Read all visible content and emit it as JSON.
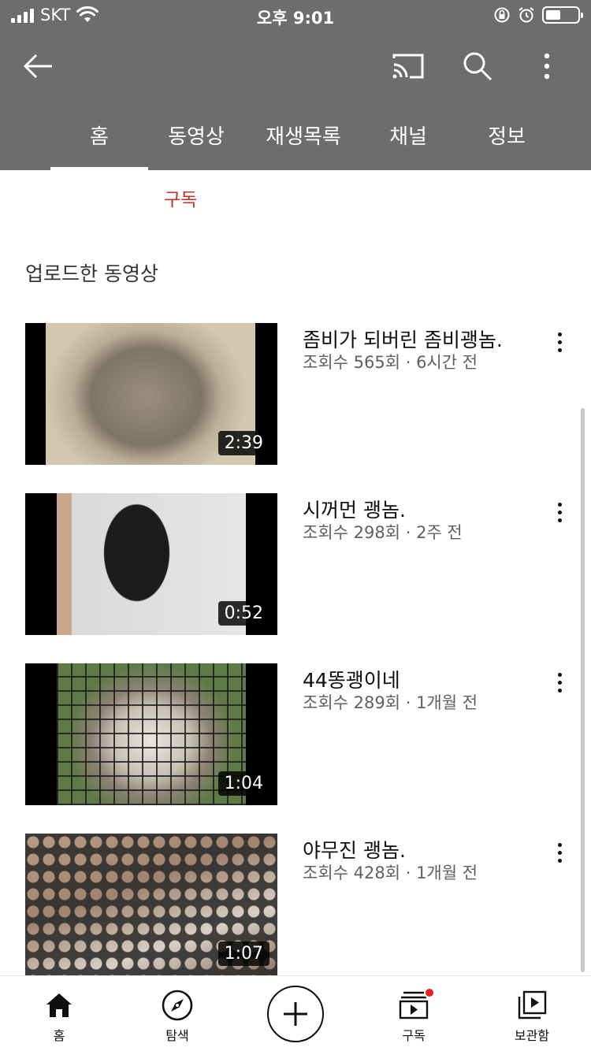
{
  "status_bar": {
    "carrier": "SKT",
    "time": "오후 9:01"
  },
  "tabs": [
    {
      "label": "홈",
      "active": true
    },
    {
      "label": "동영상",
      "active": false
    },
    {
      "label": "재생목록",
      "active": false
    },
    {
      "label": "채널",
      "active": false
    },
    {
      "label": "정보",
      "active": false
    }
  ],
  "channel": {
    "subscribe_label": "구독"
  },
  "section": {
    "title": "업로드한 동영상"
  },
  "videos": [
    {
      "title": "좀비가 되버린 좀비괭놈.",
      "meta": "조회수 565회 · 6시간 전",
      "duration": "2:39"
    },
    {
      "title": "시꺼먼 괭놈.",
      "meta": "조회수 298회 · 2주 전",
      "duration": "0:52"
    },
    {
      "title": "44똥괭이네",
      "meta": "조회수 289회 · 1개월 전",
      "duration": "1:04"
    },
    {
      "title": "야무진 괭놈.",
      "meta": "조회수 428회 · 1개월 전",
      "duration": "1:07"
    }
  ],
  "bottom_nav": {
    "home": "홈",
    "explore": "탐색",
    "subscriptions": "구독",
    "library": "보관함"
  },
  "icons": {
    "back": "arrow-left-icon",
    "cast": "cast-icon",
    "search": "search-icon",
    "more": "more-vertical-icon",
    "home": "home-icon",
    "explore": "compass-icon",
    "create": "plus-icon",
    "subscriptions": "subscriptions-icon",
    "library": "library-icon"
  },
  "colors": {
    "header_bg": "#6d6d6d",
    "subscribe": "#c4302b",
    "notification_dot": "#e62117"
  }
}
